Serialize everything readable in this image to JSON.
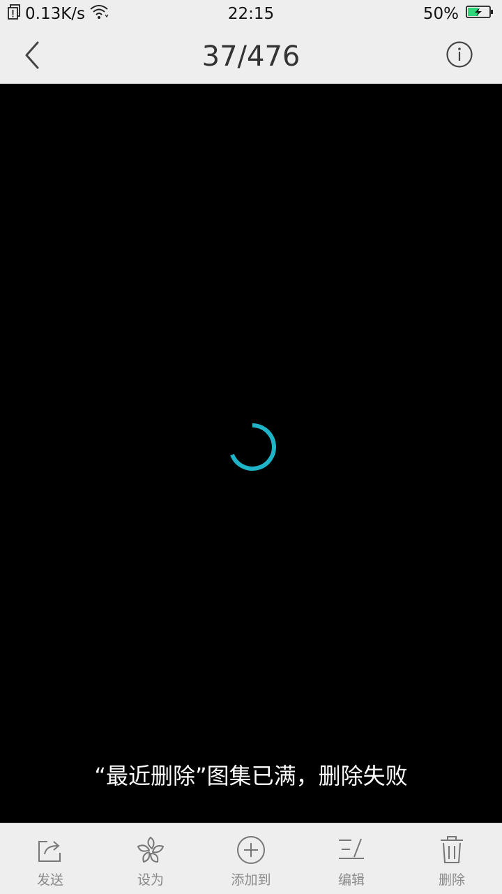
{
  "status_bar": {
    "network_speed": "0.13K/s",
    "time": "22:15",
    "battery": "50%",
    "battery_level": 0.5,
    "battery_color": "#2fd67a"
  },
  "header": {
    "title": "37/476",
    "back_icon": "chevron-left-icon",
    "info_icon": "info-icon"
  },
  "viewer": {
    "spinner_color": "#1fb3c8",
    "toast": "“最近删除”图集已满，删除失败"
  },
  "toolbar": {
    "items": [
      {
        "label": "发送",
        "icon": "share-icon"
      },
      {
        "label": "设为",
        "icon": "flower-icon"
      },
      {
        "label": "添加到",
        "icon": "add-circle-icon"
      },
      {
        "label": "编辑",
        "icon": "edit-icon"
      },
      {
        "label": "删除",
        "icon": "trash-icon"
      }
    ]
  }
}
